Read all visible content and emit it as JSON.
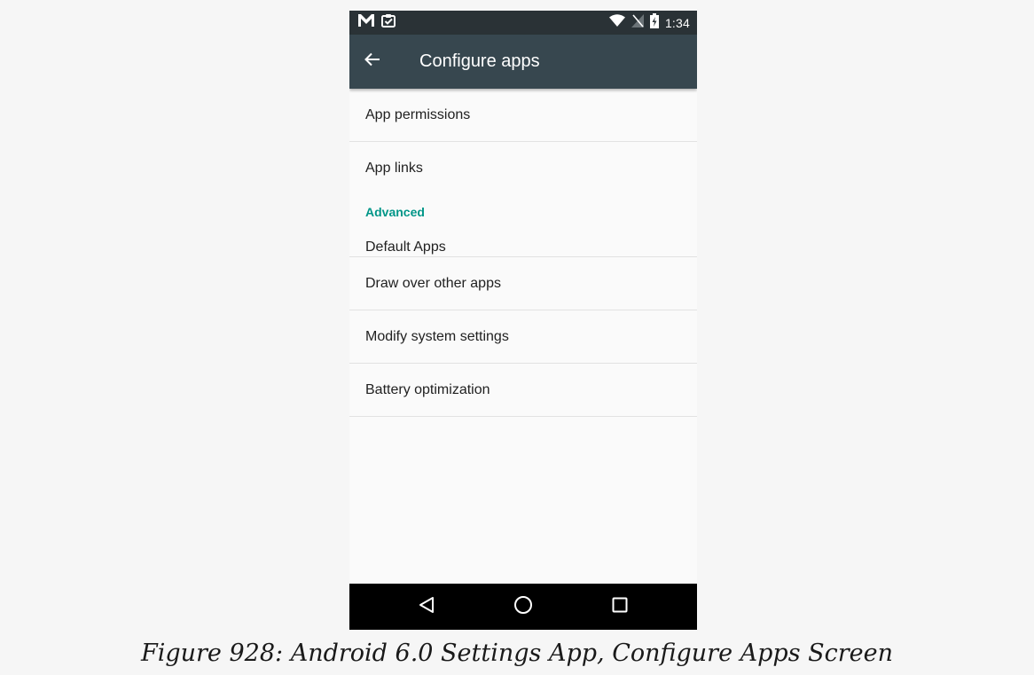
{
  "status_bar": {
    "left_icons": [
      "gmail-icon",
      "clipboard-check-icon"
    ],
    "right_icons": [
      "wifi-icon",
      "no-sim-icon",
      "battery-charging-icon"
    ],
    "time": "1:34"
  },
  "app_bar": {
    "back_icon": "arrow-back-icon",
    "title": "Configure apps"
  },
  "list": {
    "items_top": [
      {
        "label": "App permissions"
      },
      {
        "label": "App links"
      }
    ],
    "section_header": "Advanced",
    "items_advanced": [
      {
        "label": "Default Apps"
      },
      {
        "label": "Draw over other apps"
      },
      {
        "label": "Modify system settings"
      },
      {
        "label": "Battery optimization"
      }
    ]
  },
  "nav_bar": {
    "back_icon": "triangle-back-icon",
    "home_icon": "circle-home-icon",
    "recents_icon": "square-recents-icon"
  },
  "caption": "Figure 928: Android 6.0 Settings App, Configure Apps Screen",
  "colors": {
    "status_bar_bg": "#2a3236",
    "app_bar_bg": "#37474f",
    "accent": "#009688",
    "screen_bg": "#fafafa",
    "divider": "#e2e2e2",
    "nav_bar_bg": "#000000"
  }
}
